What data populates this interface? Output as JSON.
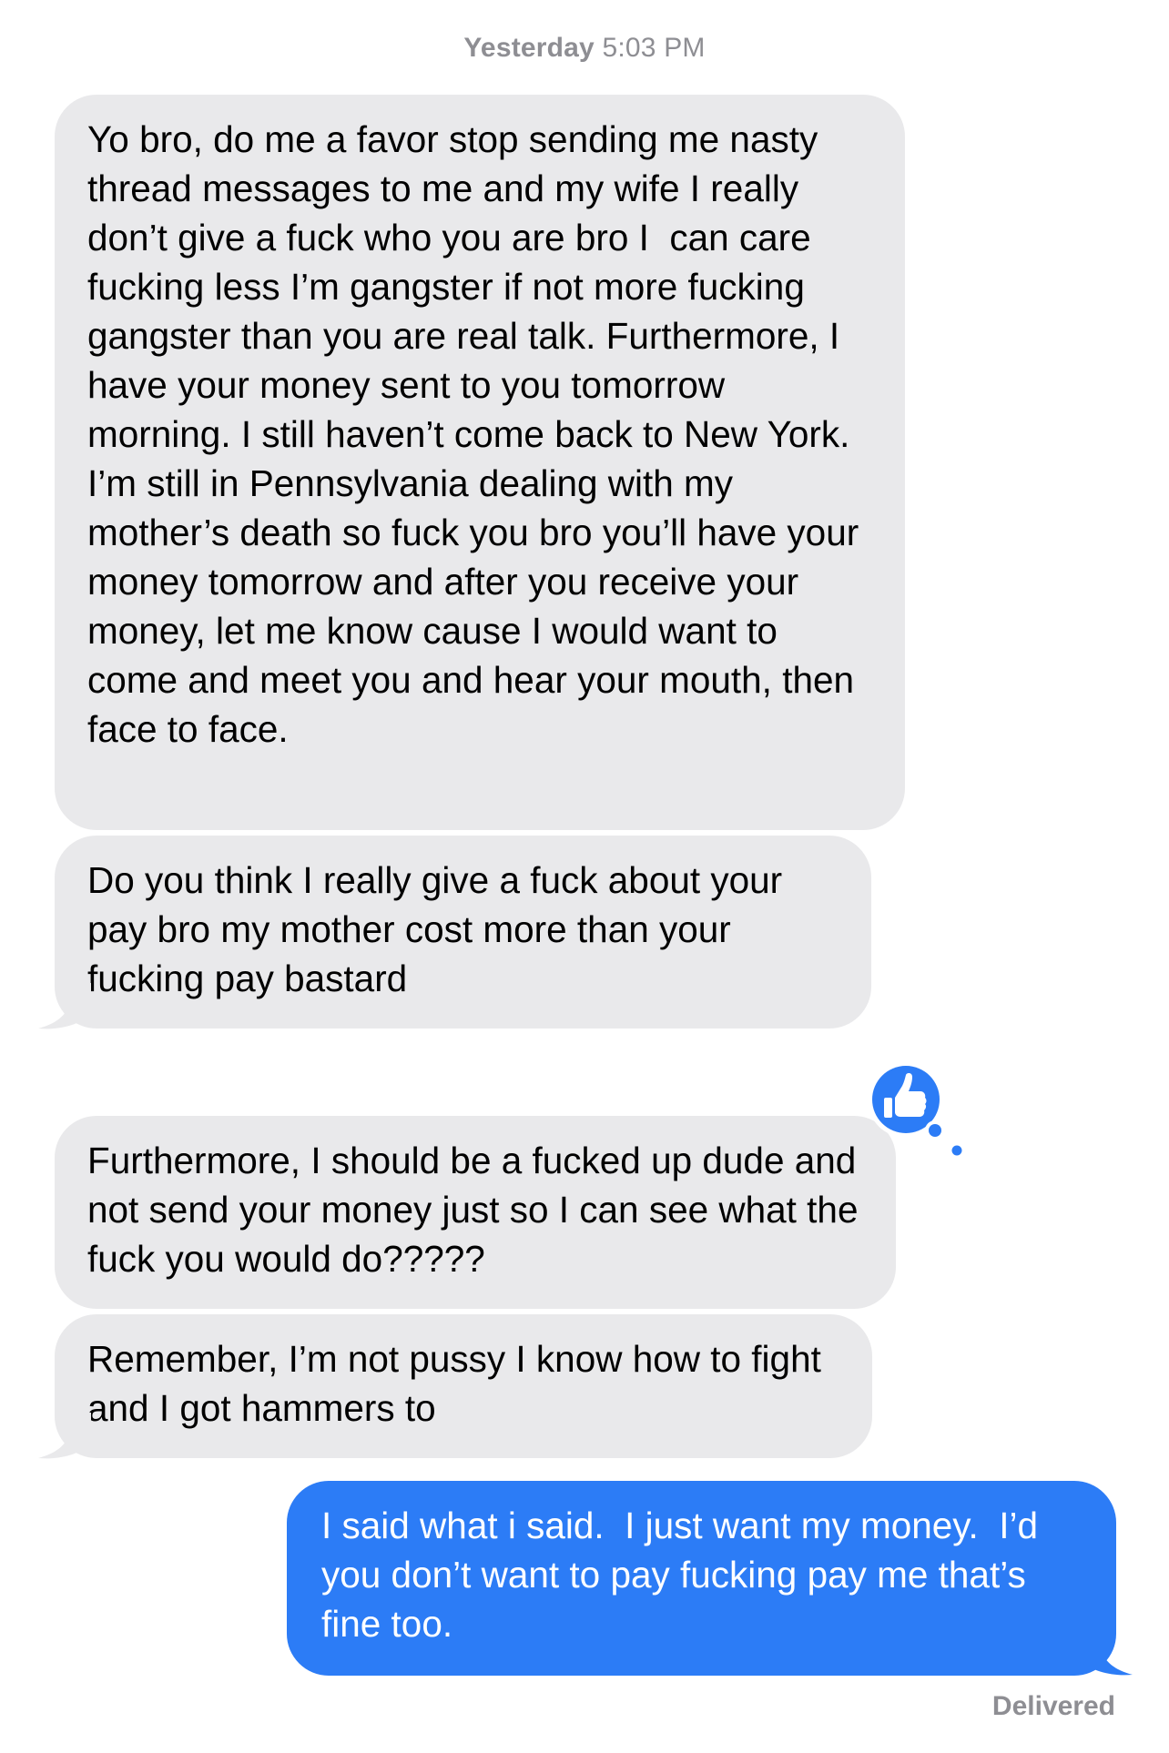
{
  "header": {
    "timestamp_day": "Yesterday",
    "timestamp_time": "5:03 PM"
  },
  "messages": [
    {
      "direction": "incoming",
      "text": "Yo bro, do me a favor stop sending me nasty thread messages to me and my wife I really don’t give a fuck who you are bro I  can care fucking less I’m gangster if not more fucking gangster than you are real talk. Furthermore, I have your money sent to you tomorrow morning. I still haven’t come back to New York. I’m still in Pennsylvania dealing with my mother’s death so fuck you bro you’ll have your money tomorrow and after you receive your money, let me know cause I would want to come and meet you and hear your mouth, then face to face."
    },
    {
      "direction": "incoming",
      "text": "Do you think I really give a fuck about your pay bro my mother cost more than your fucking pay bastard"
    },
    {
      "direction": "incoming",
      "text": "Furthermore, I should be a fucked up dude and not send your money just so I can see what the fuck you would do?????",
      "reaction": "thumbs-up"
    },
    {
      "direction": "incoming",
      "text": "Remember, I’m not pussy I know how to fight and I got hammers to"
    },
    {
      "direction": "outgoing",
      "text": "I said what i said.  I just want my money.  I’d you don’t want to pay fucking pay me that’s fine too."
    }
  ],
  "status": {
    "delivered_label": "Delivered"
  },
  "colors": {
    "incoming_bubble": "#e9e9eb",
    "outgoing_bubble": "#2c7cf6",
    "reaction_bubble": "#2c7cf6",
    "meta_text": "#8e8e93"
  }
}
